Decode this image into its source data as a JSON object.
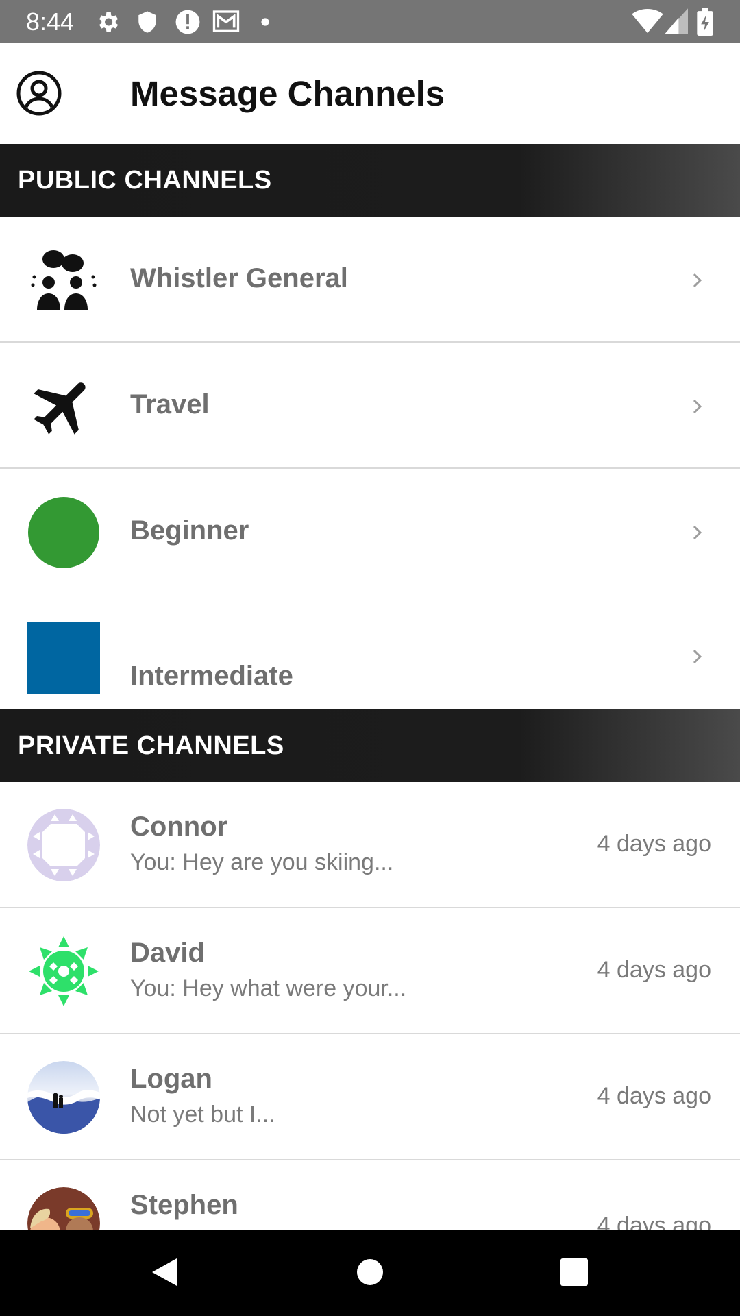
{
  "status_bar": {
    "time": "8:44",
    "left_icons": [
      "settings-icon",
      "shield-icon",
      "alert-icon",
      "mail-icon",
      "dot-icon"
    ],
    "right_icons": [
      "wifi-icon",
      "signal-icon",
      "battery-charging-icon"
    ]
  },
  "app_bar": {
    "title": "Message Channels",
    "profile_icon": "account-circle-icon"
  },
  "public_section": {
    "header": "PUBLIC CHANNELS",
    "channels": [
      {
        "name": "Whistler General",
        "icon": "group-chat-icon"
      },
      {
        "name": "Travel",
        "icon": "airplane-icon"
      },
      {
        "name": "Beginner",
        "icon": "green-circle-icon",
        "color": "#339933"
      },
      {
        "name": "Intermediate",
        "icon": "blue-square-icon",
        "color": "#0066a1"
      }
    ]
  },
  "private_section": {
    "header": "PRIVATE CHANNELS",
    "chats": [
      {
        "name": "Connor",
        "preview": "You: Hey are you skiing...",
        "time": "4 days ago"
      },
      {
        "name": "David",
        "preview": "You: Hey what were your...",
        "time": "4 days ago"
      },
      {
        "name": "Logan",
        "preview": "Not yet but I...",
        "time": "4 days ago"
      },
      {
        "name": "Stephen",
        "preview": "",
        "time": "4 days ago"
      }
    ]
  },
  "nav_bar": {
    "buttons": [
      "back-icon",
      "home-icon",
      "recents-icon"
    ]
  }
}
